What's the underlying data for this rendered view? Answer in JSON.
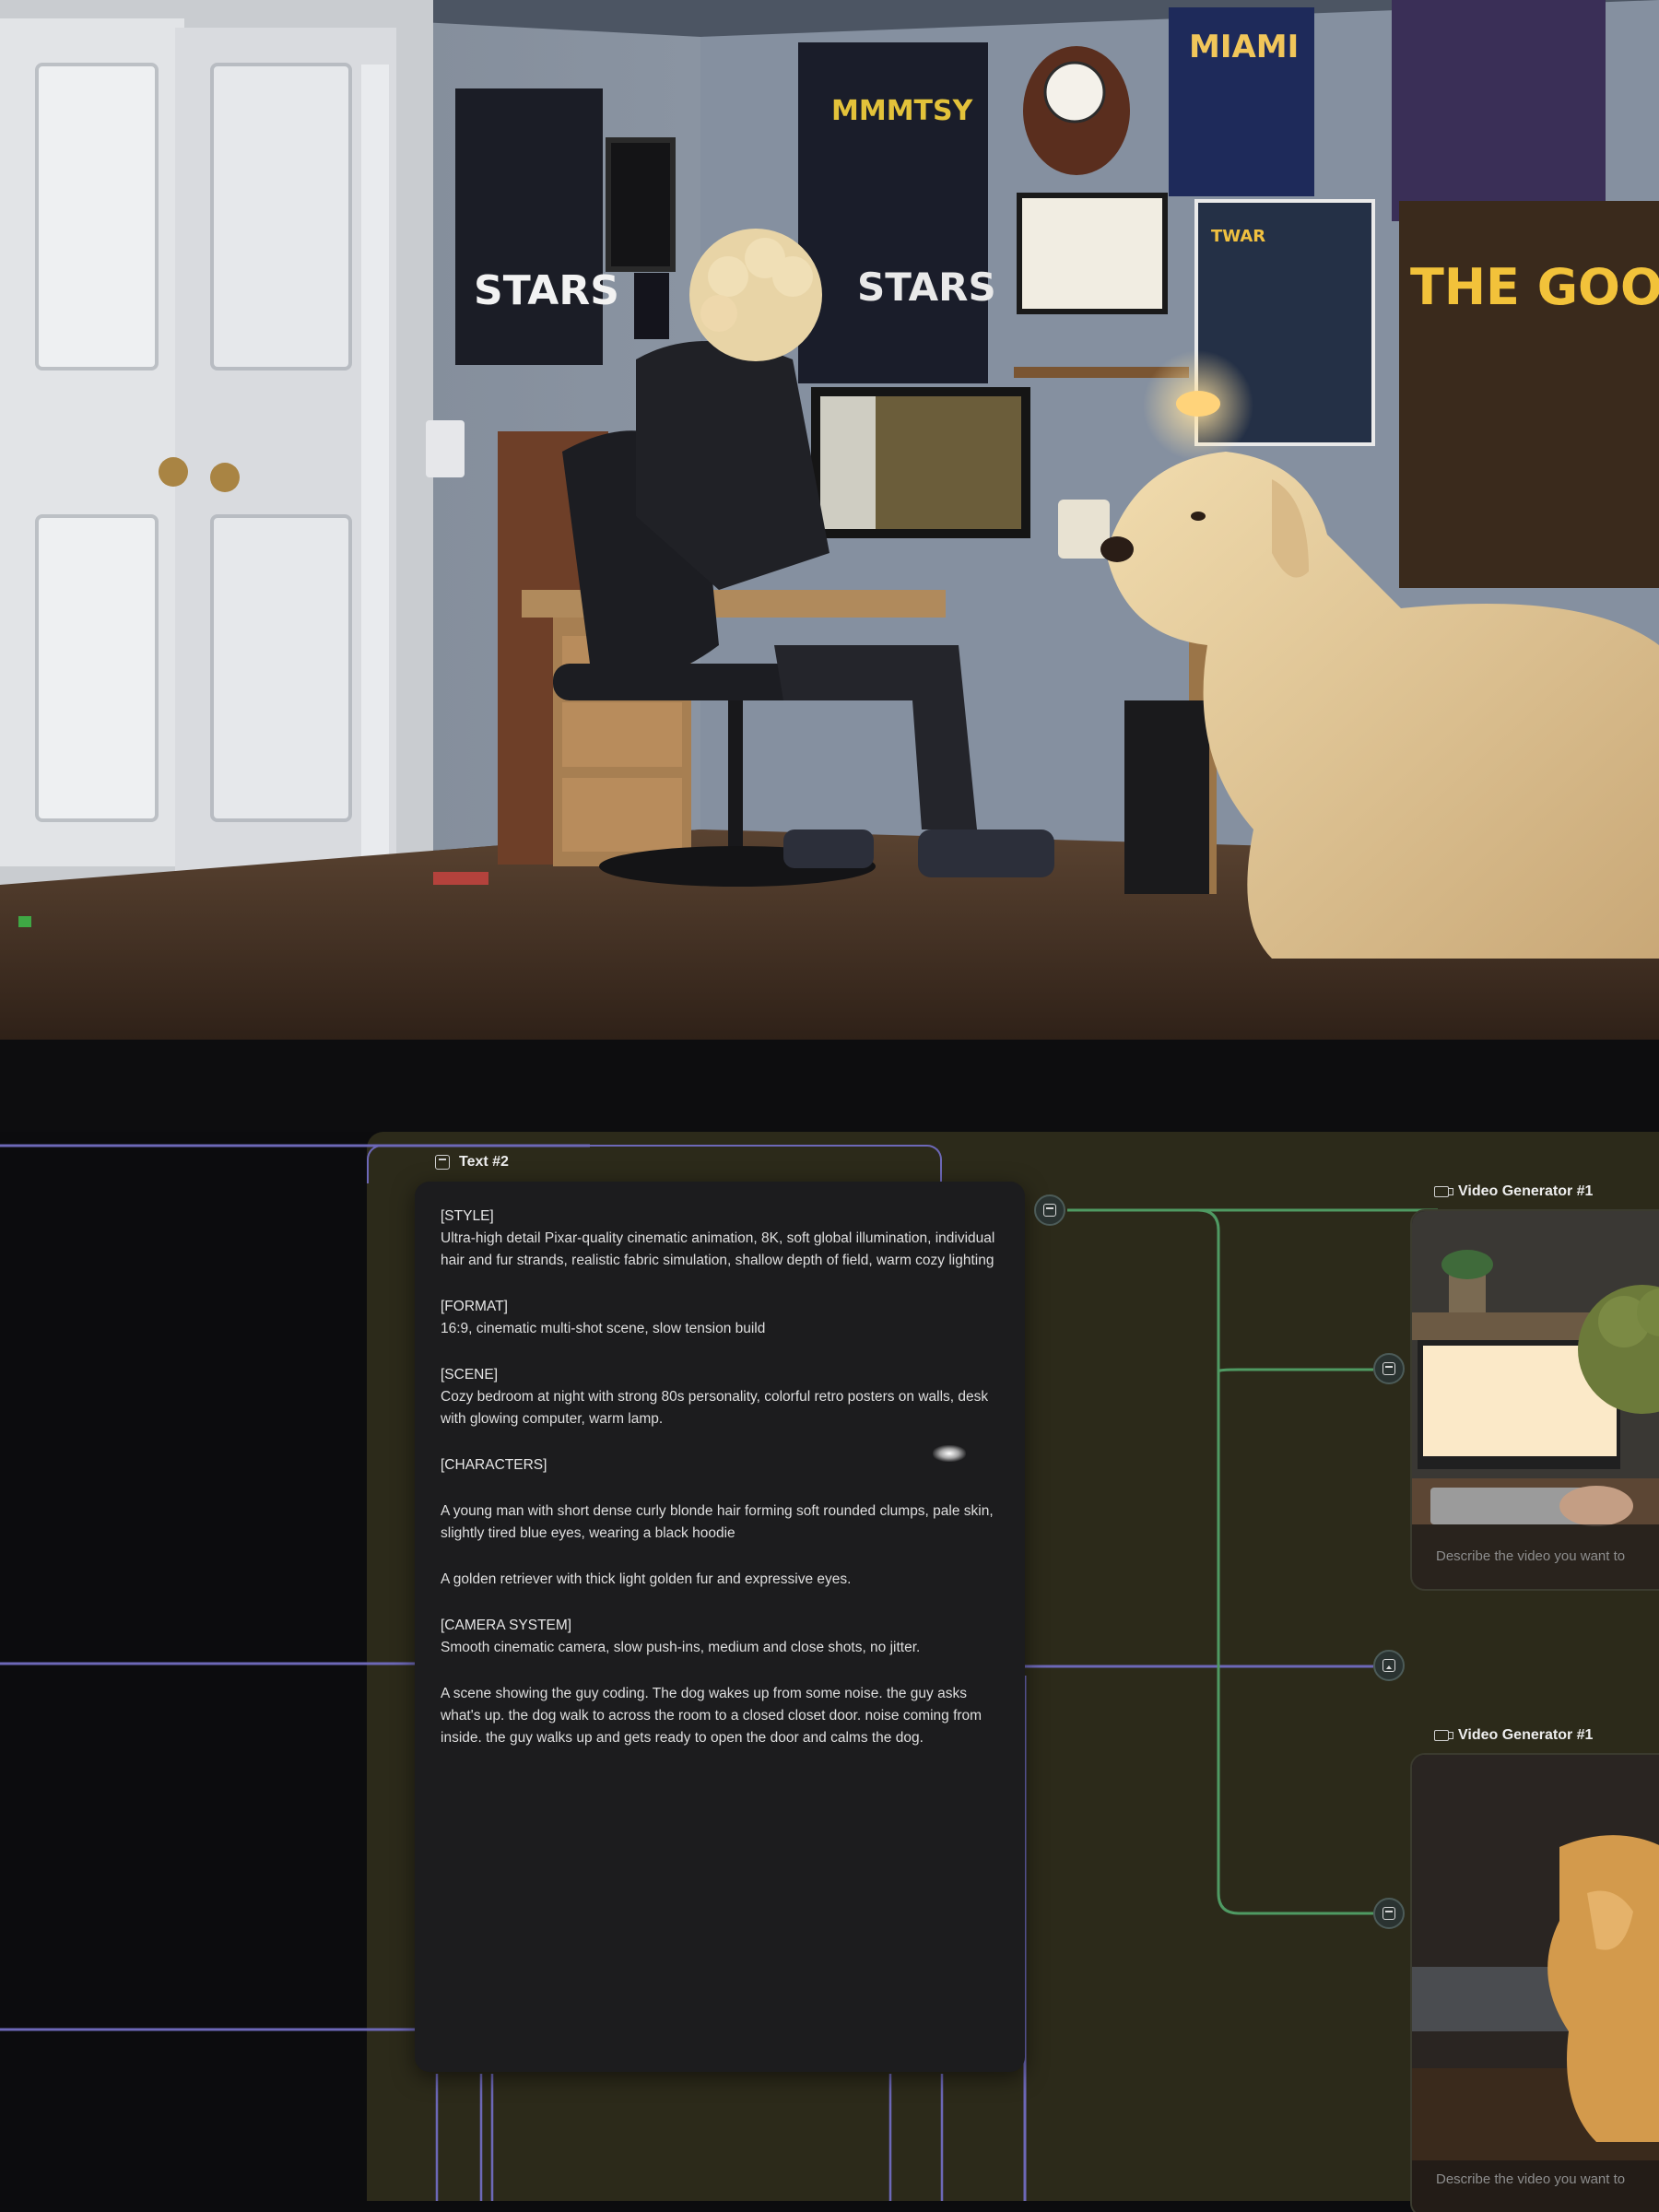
{
  "render_scene": {
    "posters": [
      "STARS",
      "MMMTSY",
      "THE STARS",
      "MIAMI",
      "TWAR",
      "THE GOONIE"
    ]
  },
  "text_node": {
    "title": "Text #2",
    "style_head": "[STYLE]",
    "style_body": "Ultra-high detail Pixar-quality cinematic animation, 8K, soft global illumination, individual hair and fur strands, realistic fabric simulation, shallow depth of field, warm cozy lighting",
    "format_head": "[FORMAT]",
    "format_body": "16:9, cinematic multi-shot scene, slow tension build",
    "scene_head": "[SCENE]",
    "scene_body": "Cozy bedroom at night with strong 80s personality, colorful retro posters on walls, desk with glowing computer, warm lamp.",
    "characters_head": "[CHARACTERS]",
    "characters_body_1": "A young man with short dense curly blonde hair forming soft rounded clumps, pale skin, slightly tired blue eyes, wearing a black hoodie",
    "characters_body_2": "A golden retriever with thick light golden fur and expressive eyes.",
    "camera_head": "[CAMERA SYSTEM]",
    "camera_body": "Smooth cinematic camera, slow push-ins, medium and close shots, no jitter.",
    "action_body": "A scene showing the guy coding. The dog wakes up from some noise. the guy asks what's up. the dog walk to across the room to a closed closet door. noise coming from inside. the guy walks up and gets ready to open the door and calms the dog."
  },
  "video_nodes": [
    {
      "title": "Video Generator #1",
      "placeholder": "Describe the video you want to"
    },
    {
      "title": "Video Generator #1",
      "placeholder": "Describe the video you want to"
    }
  ],
  "colors": {
    "wire_purple": "#6d68b8",
    "wire_green": "#4f9a63",
    "group_bg": "#2c2a1a",
    "card_bg": "#1c1c1e"
  },
  "icons": [
    "text-node-icon",
    "video-camera-icon",
    "text-port-icon",
    "image-port-icon"
  ]
}
